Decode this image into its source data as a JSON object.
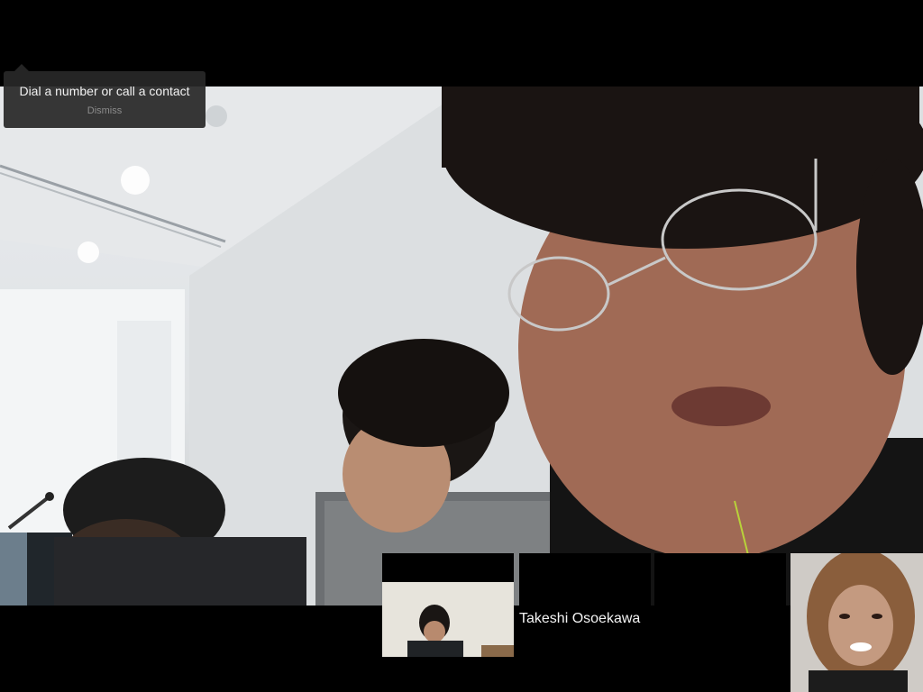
{
  "hint": {
    "message": "Dial a number or call a contact",
    "dismiss_label": "Dismiss"
  },
  "participants": [
    {
      "name": "",
      "has_video": true
    },
    {
      "name": "Takeshi Osoekawa",
      "has_video": false
    },
    {
      "name": "",
      "has_video": false
    },
    {
      "name": "",
      "is_self": true,
      "has_video": true
    }
  ],
  "colors": {
    "background": "#000000",
    "hint_background": "#282828",
    "hint_text": "#f2f2f2",
    "dismiss_text": "#8c8c8c"
  }
}
